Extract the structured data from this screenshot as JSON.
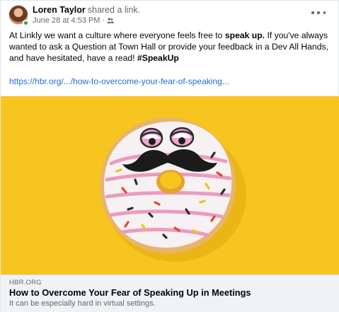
{
  "post": {
    "author": "Loren Taylor",
    "action": "shared a link.",
    "timestamp": "June 28 at 4:53 PM",
    "separator": "·",
    "audience_icon": "friends-icon",
    "more_icon": "more-options-icon",
    "text": {
      "part1": "At Linkly we want a culture where everyone feels free to ",
      "bold1": "speak up.",
      "part2": " If you've always wanted to ask a Question at Town Hall or provide your feedback in a Dev All Hands, and have hesitated, have a read! ",
      "hashtag": "#SpeakUp"
    },
    "link_url": "https://hbr.org/.../how-to-overcome-your-fear-of-speaking..."
  },
  "link_card": {
    "domain": "HBR.ORG",
    "title": "How to Overcome Your Fear of Speaking Up in Meetings",
    "description": "It can be especially hard in virtual settings."
  },
  "colors": {
    "image_background": "#f7c520",
    "link": "#216fdb",
    "online": "#31a24c"
  }
}
